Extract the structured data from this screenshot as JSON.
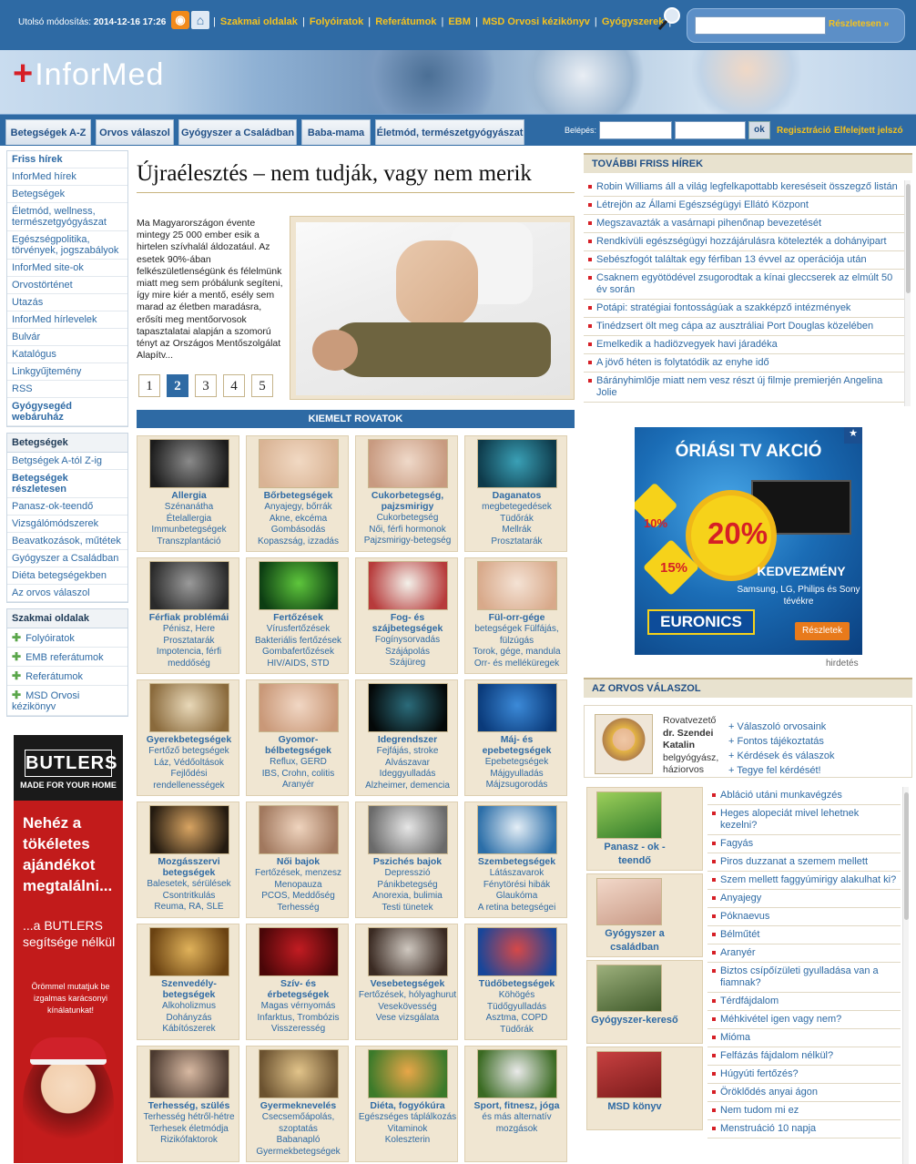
{
  "top": {
    "updated_label": "Utolsó módosítás:",
    "updated_value": "2014-12-16 17:26",
    "nav": [
      "Szakmai oldalak",
      "Folyóiratok",
      "Referátumok",
      "EBM",
      "MSD Orvosi kézikönyv",
      "Gyógyszerek"
    ],
    "search_button": "Részletesen »"
  },
  "logo": {
    "text": "InforMed"
  },
  "mainnav": {
    "tabs": [
      "Betegségek A-Z",
      "Orvos válaszol",
      "Gyógyszer a Családban",
      "Baba-mama",
      "Életmód, természetgyógyászat"
    ],
    "login_label": "Belépés:",
    "ok": "ok",
    "register": "Regisztráció",
    "forgot": "Elfelejtett jelszó"
  },
  "sidebar": {
    "box1": [
      "Friss hírek",
      "InforMed hírek",
      "Betegségek",
      "Életmód, wellness, természetgyógyászat",
      "Egészségpolitika, törvények, jogszabályok",
      "InforMed site-ok",
      "Orvostörténet",
      "Utazás",
      "InforMed hírlevelek",
      "Bulvár",
      "Katalógus",
      "Linkgyűjtemény",
      "RSS",
      "Gyógysegéd webáruház"
    ],
    "box2_head": "Betegségek",
    "box2": [
      "Betgségek A-tól Z-ig",
      "Betegségek részletesen",
      "Panasz-ok-teendő",
      "Vizsgálómódszerek",
      "Beavatkozások, műtétek",
      "Gyógyszer a Családban",
      "Diéta betegségekben",
      "Az orvos válaszol"
    ],
    "box3_head": "Szakmai oldalak",
    "box3": [
      "Folyóiratok",
      "EMB referátumok",
      "Referátumok",
      "MSD Orvosi kézikönyv"
    ]
  },
  "butlers": {
    "brand": "BUTLERS",
    "sub": "MADE FOR YOUR HOME",
    "big": "Nehéz a tökéletes ajándékot megtalálni...",
    "mid": "...a BUTLERS segítsége nélkül",
    "small": "Örömmel mutatjuk be izgalmas karácsonyi kínálatunkat!"
  },
  "article": {
    "headline": "Újraélesztés – nem tudják, vagy nem merik",
    "lead": "Ma Magyarországon évente mintegy 25 000 ember esik a hirtelen szívhalál áldozatául. Az esetek 90%-ában felkészületlenségünk és félelmünk miatt meg sem próbálunk segíteni, így mire kiér a mentő, esély sem marad az életben maradásra, erősíti meg mentőorvosok tapasztalatai alapján a szomorú tényt az Országos Mentőszolgálat Alapítv...",
    "pages": [
      "1",
      "2",
      "3",
      "4",
      "5"
    ],
    "active_page": 2
  },
  "kiemelt": {
    "title": "KIEMELT ROVATOK"
  },
  "categories": [
    {
      "title": "Allergia",
      "desc": "Szénanátha\nÉtelallergia\nImmunbetegségek\nTranszplantáció",
      "colors": [
        "#1c1c1c",
        "#8a8a8a"
      ]
    },
    {
      "title": "Bőrbetegségek",
      "desc": "Anyajegy, bőrrák\nAkne, ekcéma\nGombásodás\nKopaszság, izzadás",
      "colors": [
        "#d9b394",
        "#f1d9c3"
      ]
    },
    {
      "title": "Cukorbetegség, pajzsmirigy",
      "desc": "Cukorbetegség\nNői, férfi hormonok\nPajzsmirigy-betegség",
      "colors": [
        "#c89a80",
        "#efd9c9"
      ]
    },
    {
      "title": "Daganatos",
      "desc": "megbetegedések\nTüdőrák\nMellrák\nProsztatarák",
      "colors": [
        "#0e3a4a",
        "#3aa0b6"
      ]
    },
    {
      "title": "Férfiak problémái",
      "desc": "Pénisz, Here\nProsztatarák\nImpotencia, férfi meddőség",
      "colors": [
        "#2a2a2a",
        "#9a9a9a"
      ]
    },
    {
      "title": "Fertőzések",
      "desc": "Vírusfertőzések\nBakteriális fertőzések\nGombafertőzések\nHIV/AIDS, STD",
      "colors": [
        "#0c3d12",
        "#5ec63c"
      ]
    },
    {
      "title": "Fog- és szájbetegségek",
      "desc": "Fogínysorvadás\nSzájápolás\nSzájüreg",
      "colors": [
        "#b73b3b",
        "#f3f1ea"
      ]
    },
    {
      "title": "Fül-orr-gége",
      "desc": "betegségek Fülfájás, fülzúgás\nTorok, gége, mandula\nOrr- és melléküregek",
      "colors": [
        "#d8a98a",
        "#f4e2d4"
      ]
    },
    {
      "title": "Gyerekbetegségek",
      "desc": "Fertőző betegségek\nLáz, Védőoltások\nFejlődési rendellenességek",
      "colors": [
        "#8a6a3c",
        "#e8d8b8"
      ]
    },
    {
      "title": "Gyomor-bélbetegségek",
      "desc": "Reflux, GERD\nIBS, Crohn, colitis\nAranyér",
      "colors": [
        "#c99878",
        "#f1d7c4"
      ]
    },
    {
      "title": "Idegrendszer",
      "desc": "Fejfájás, stroke\nAlvászavar\nIdeggyulladás\nAlzheimer, demencia",
      "colors": [
        "#040808",
        "#2b6b7a"
      ]
    },
    {
      "title": "Máj- és epebetegségek",
      "desc": "Epebetegségek\nMájgyulladás\nMájzsugorodás",
      "colors": [
        "#0a3a7a",
        "#3c8ad8"
      ]
    },
    {
      "title": "Mozgásszervi betegségek",
      "desc": "Balesetek, sérülések\nCsontritkulás\nReuma, RA, SLE",
      "colors": [
        "#231a10",
        "#d8a462"
      ]
    },
    {
      "title": "Női bajok",
      "desc": "Fertőzések, menzesz\nMenopauza\nPCOS, Meddőség\nTerhesség",
      "colors": [
        "#a1785e",
        "#efd4be"
      ]
    },
    {
      "title": "Pszichés bajok",
      "desc": "Depresszió\nPánikbetegség\nAnorexia, bulimia\nTesti tünetek",
      "colors": [
        "#6a6a6a",
        "#e6e6e6"
      ]
    },
    {
      "title": "Szembetegségek",
      "desc": "Látászavarok\nFénytörési hibák\nGlaukóma\nA retina betegségei",
      "colors": [
        "#2b6ea8",
        "#e4eef6"
      ]
    },
    {
      "title": "Szenvedély-betegségek",
      "desc": "Alkoholizmus\nDohányzás\nKábítószerek",
      "colors": [
        "#6a4212",
        "#e0b25a"
      ]
    },
    {
      "title": "Szív- és érbetegségek",
      "desc": "Magas vérnyomás\nInfarktus, Trombózis\nVisszeresség",
      "colors": [
        "#4a0608",
        "#c21c22"
      ]
    },
    {
      "title": "Vesebetegségek",
      "desc": "Fertőzések, hólyaghurut\nVesekövesség\nVese vizsgálata",
      "colors": [
        "#3a2a22",
        "#cfc8c0"
      ]
    },
    {
      "title": "Tüdőbetegségek",
      "desc": "Köhögés\nTüdőgyulladás\nAsztma, COPD\nTüdőrák",
      "colors": [
        "#18469a",
        "#d64848"
      ]
    },
    {
      "title": "Terhesség, szülés",
      "desc": "Terhesség hétről-hétre\nTerhesek életmódja\nRizikófaktorok",
      "colors": [
        "#4b3a30",
        "#d8b9a2"
      ]
    },
    {
      "title": "Gyermeknevelés",
      "desc": "Csecsemőápolás, szoptatás\nBabanapló\nGyermekbetegségek",
      "colors": [
        "#6b5230",
        "#e2c48a"
      ]
    },
    {
      "title": "Diéta, fogyókúra",
      "desc": "Egészséges táplálkozás\nVitaminok\nKoleszterin",
      "colors": [
        "#3b7a2a",
        "#e8a648"
      ]
    },
    {
      "title": "Sport, fitnesz, jóga",
      "desc": "és más alternatív mozgások",
      "colors": [
        "#3a6a22",
        "#eaeaea"
      ]
    }
  ],
  "news": {
    "title": "TOVÁBBI FRISS HÍREK",
    "items": [
      "Robin Williams áll a világ legfelkapottabb kereséseit összegző listán",
      "Létrejön az Állami Egészségügyi Ellátó Központ",
      "Megszavazták a vasárnapi pihenőnap bevezetését",
      "Rendkívüli egészségügyi hozzájárulásra kötelezték a dohányipart",
      "Sebészfogót találtak egy férfiban 13 évvel az operációja után",
      "Csaknem egyötödével zsugorodtak a kínai gleccserek az elmúlt 50 év során",
      "Potápi: stratégiai fontosságúak a szakképző intézmények",
      "Tinédzsert ölt meg cápa az ausztráliai Port Douglas közelében",
      "Emelkedik a hadiözvegyek havi járadéka",
      "A jövő héten is folytatódik az enyhe idő",
      "Bárányhimlője miatt nem vesz részt új filmje premierjén Angelina Jolie"
    ]
  },
  "euronics": {
    "title": "ÓRIÁSI TV AKCIÓ",
    "p10": "10%",
    "p20": "20%",
    "p15": "15%",
    "kedv": "KEDVEZMÉNY",
    "brands": "Samsung, LG, Philips és Sony tévékre",
    "logo": "EURONICS",
    "btn": "Részletek",
    "close": "★",
    "hirdetes": "hirdetés"
  },
  "orvos": {
    "title": "AZ ORVOS VÁLASZOL",
    "role": "Rovatvezető",
    "name": "dr. Szendei Katalin",
    "spec": "belgyógyász, háziorvos",
    "links": [
      "+ Válaszoló orvosaink",
      "+ Fontos tájékoztatás",
      "+ Kérdések és válaszok",
      "+ Tegye fel kérdését!"
    ],
    "tiles": [
      "Panasz - ok - teendő",
      "Gyógyszer a családban",
      "Gyógyszer-kereső",
      "MSD könyv"
    ],
    "questions": [
      "Abláció utáni munkavégzés",
      "Heges alopeciát mivel lehetnek kezelni?",
      "Fagyás",
      "Piros duzzanat a szemem mellett",
      "Szem mellett faggyúmirigy alakulhat ki?",
      "Anyajegy",
      "Póknaevus",
      "Bélműtét",
      "Aranyér",
      "Biztos csípőízületi gyulladása van a fiamnak?",
      "Térdfájdalom",
      "Méhkivétel igen vagy nem?",
      "Mióma",
      "Felfázás fájdalom nélkül?",
      "Húgyúti fertőzés?",
      "Öröklődés anyai ágon",
      "Nem tudom mi ez",
      "Menstruáció 10 napja"
    ]
  }
}
